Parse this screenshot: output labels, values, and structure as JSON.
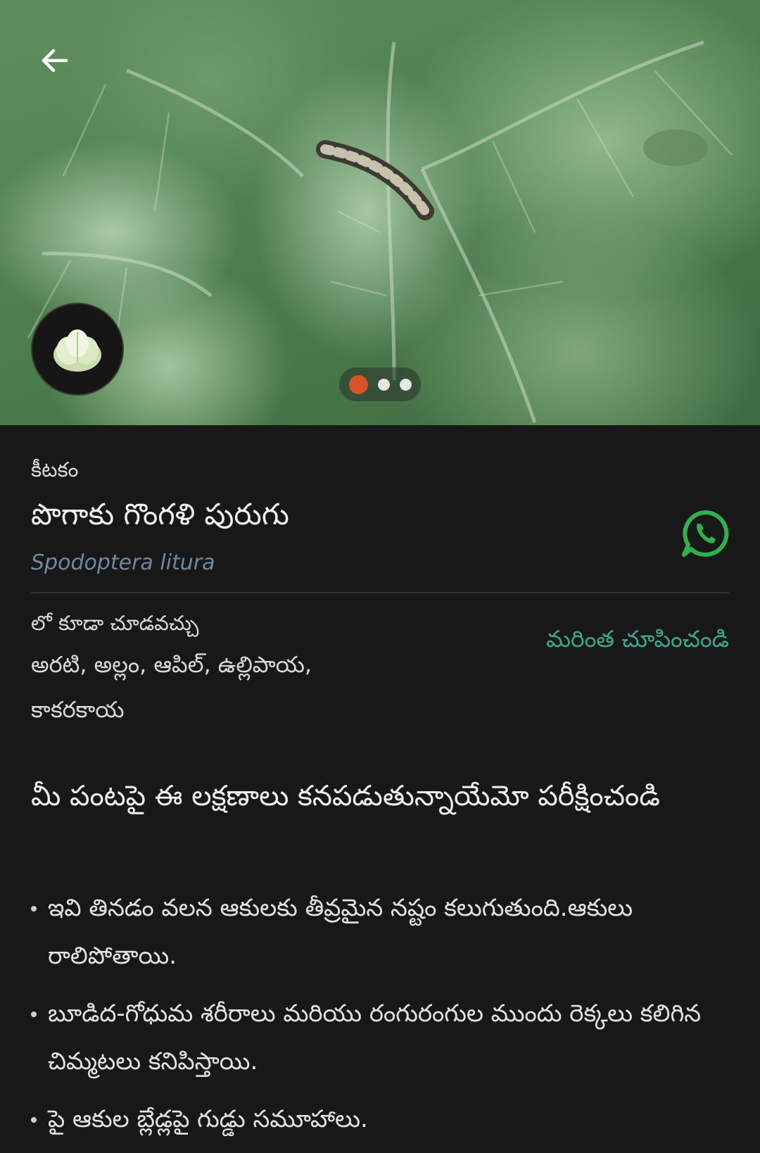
{
  "hero": {
    "image_description_icon": "cabbage-caterpillar-photo",
    "crop_icon": "cabbage-icon",
    "slides_total": 3,
    "slide_active": 1,
    "accent_dot_color": "#d8532a"
  },
  "pest": {
    "category": "కీటకం",
    "name": "పొగాకు గొంగళి పురుగు",
    "scientific_name": "Spodoptera litura"
  },
  "also_seen": {
    "label": "లో కూడా చూడవచ్చు",
    "crops": "అరటి, అల్లం, ఆపిల్, ఉల్లిపాయ, కాకరకాయ",
    "show_more": "మరింత చూపించండి"
  },
  "symptoms": {
    "heading": "మీ పంటపై ఈ లక్షణాలు కనపడుతున్నాయేమో పరీక్షించండి",
    "items": [
      "ఇవి తినడం వలన ఆకులకు తీవ్రమైన నష్టం కలుగుతుంది.ఆకులు రాలిపోతాయి.",
      "బూడిద-గోధుమ శరీరాలు మరియు రంగురంగుల ముందు రెక్కలు కలిగిన చిమ్మటలు కనిపిస్తాయి.",
      "పై ఆకుల బ్లేడ్లపై గుడ్డు సమూహాలు."
    ]
  },
  "colors": {
    "background": "#181819",
    "link": "#3fa58e",
    "scientific": "#6f8aa0",
    "whatsapp": "#2fb24c"
  }
}
